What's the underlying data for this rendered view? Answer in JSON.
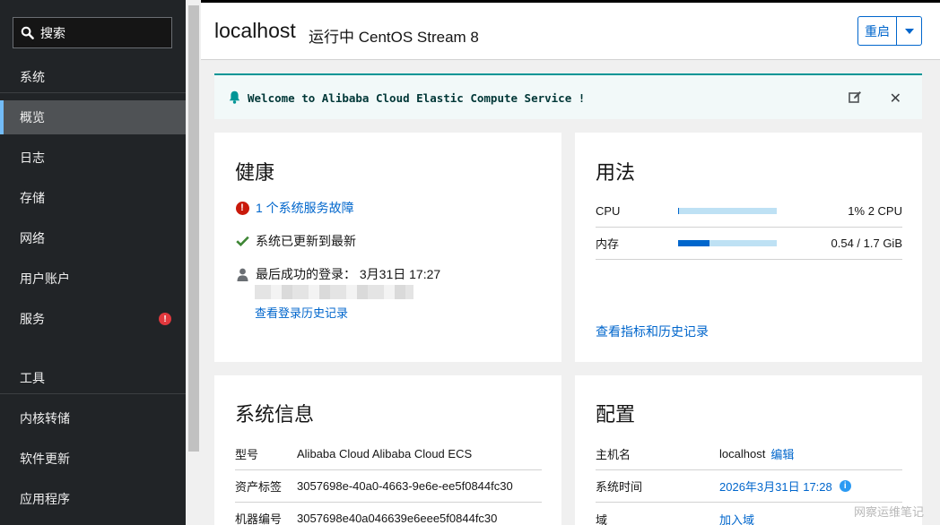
{
  "sidebar": {
    "search_label": "搜索",
    "section_system": "系统",
    "items": [
      {
        "label": "概览",
        "active": true
      },
      {
        "label": "日志"
      },
      {
        "label": "存储"
      },
      {
        "label": "网络"
      },
      {
        "label": "用户账户"
      },
      {
        "label": "服务",
        "badge": "!"
      }
    ],
    "section_tools": "工具",
    "tools": [
      {
        "label": "内核转储"
      },
      {
        "label": "软件更新"
      },
      {
        "label": "应用程序"
      }
    ]
  },
  "header": {
    "hostname": "localhost",
    "status": "运行中 CentOS Stream 8",
    "restart_label": "重启"
  },
  "banner": {
    "text": "Welcome to Alibaba Cloud Elastic Compute Service !"
  },
  "health": {
    "title": "健康",
    "failure_link": "1 个系统服务故障",
    "updated_text": "系统已更新到最新",
    "last_login": "最后成功的登录： 3月31日 17:27",
    "history_link": "查看登录历史记录"
  },
  "usage": {
    "title": "用法",
    "rows": [
      {
        "label": "CPU",
        "value": "1% 2 CPU",
        "fraction": 0.01
      },
      {
        "label": "内存",
        "value": "0.54 / 1.7 GiB",
        "fraction": 0.32
      }
    ],
    "metrics_link": "查看指标和历史记录"
  },
  "sysinfo": {
    "title": "系统信息",
    "rows": [
      {
        "key": "型号",
        "value": "Alibaba Cloud Alibaba Cloud ECS"
      },
      {
        "key": "资产标签",
        "value": "3057698e-40a0-4663-9e6e-ee5f0844fc30"
      },
      {
        "key": "机器编号",
        "value": "3057698e40a046639e6eee5f0844fc30"
      }
    ]
  },
  "config": {
    "title": "配置",
    "rows": [
      {
        "key": "主机名",
        "value": "localhost",
        "link": "编辑"
      },
      {
        "key": "系统时间",
        "value": "2026年3月31日 17:28"
      },
      {
        "key": "域",
        "link": "加入域"
      }
    ]
  },
  "watermark": "网察运维笔记",
  "colors": {
    "accent": "#0066cc",
    "sidebar_bg": "#212427",
    "banner_border": "#009596",
    "danger": "#c9190b",
    "success": "#3e8635"
  }
}
